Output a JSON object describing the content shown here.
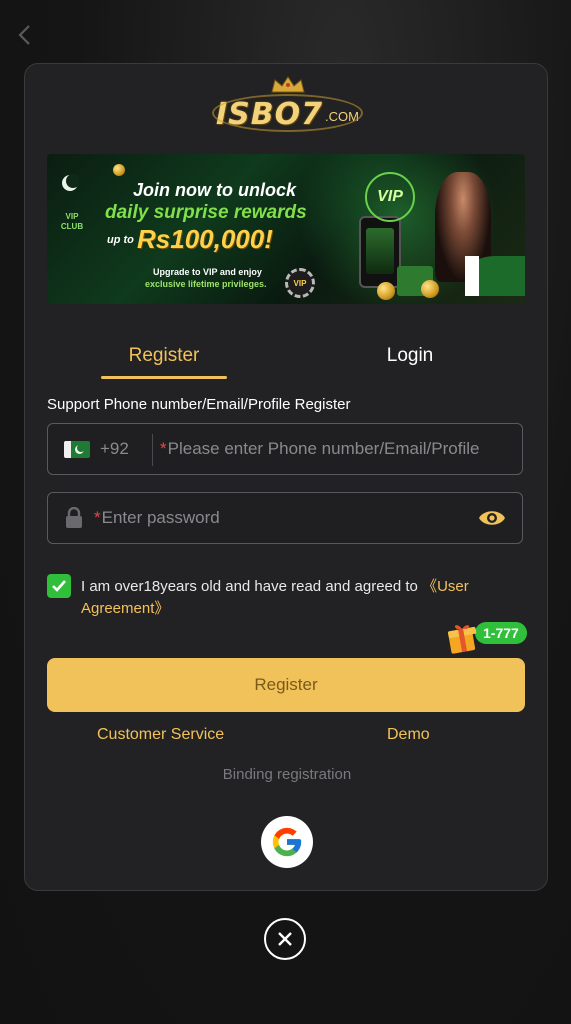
{
  "brand": {
    "logo_text": "ISBO7",
    "logo_suffix": ".COM"
  },
  "banner": {
    "line1": "Join now to unlock",
    "line2": "daily surprise rewards",
    "up_to": "up to",
    "amount": "Rs100,000!",
    "sub1": "Upgrade to VIP and enjoy",
    "sub2": "exclusive lifetime privileges.",
    "vip_club": "VIP CLUB",
    "vip_badge": "VIP",
    "chip_label": "VIP"
  },
  "tabs": [
    {
      "label": "Register",
      "active": true
    },
    {
      "label": "Login",
      "active": false
    }
  ],
  "form": {
    "support_label": "Support Phone number/Email/Profile Register",
    "country_code": "+92",
    "phone_placeholder": "Please enter Phone number/Email/Profile",
    "password_placeholder": "Enter password",
    "required_mark": "*"
  },
  "agreement": {
    "checked": true,
    "text": "I am over18years old and have read and agreed to ",
    "link": "《User Agreement》"
  },
  "gift": {
    "badge": "1-777"
  },
  "actions": {
    "register_label": "Register",
    "customer_service": "Customer Service",
    "demo": "Demo",
    "binding": "Binding registration"
  },
  "colors": {
    "accent": "#f2c25a",
    "success": "#2fbf3a",
    "background": "#161616",
    "modal": "#222224"
  }
}
